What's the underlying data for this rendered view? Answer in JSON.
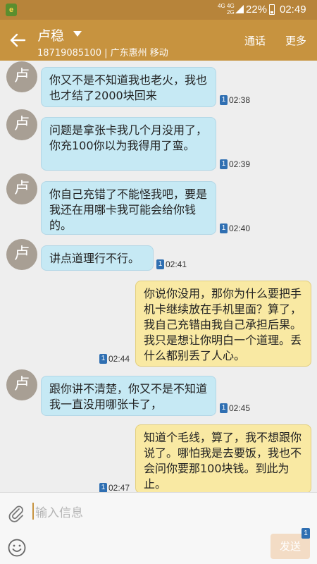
{
  "status_bar": {
    "app_icon_label": "e",
    "network_1": "4G",
    "network_2": "4G",
    "network_3": "2G",
    "battery": "22%",
    "time": "02:49"
  },
  "header": {
    "contact_name": "卢稳",
    "contact_sub": "18719085100 | 广东惠州 移动",
    "call_label": "通话",
    "more_label": "更多"
  },
  "avatar_label": "卢",
  "sim_label": "1",
  "messages": [
    {
      "direction": "in",
      "text": "你又不是不知道我也老火，我也也才结了2000块回来",
      "time": "02:38"
    },
    {
      "direction": "in",
      "text": "问题是拿张卡我几个月没用了，你充100你以为我得用了蛮。",
      "time": "02:39"
    },
    {
      "direction": "in",
      "text": "你自己充错了不能怪我吧，要是我还在用哪卡我可能会给你钱的。",
      "time": "02:40"
    },
    {
      "direction": "in",
      "text": "讲点道理行不行。",
      "time": "02:41"
    },
    {
      "direction": "out",
      "text": "你说你没用，那你为什么要把手机卡继续放在手机里面？算了，我自己充错由我自己承担后果。我只是想让你明白一个道理。丢什么都别丢了人心。",
      "time": "02:44"
    },
    {
      "direction": "in",
      "text": "跟你讲不清楚，你又不是不知道我一直没用哪张卡了，",
      "time": "02:45"
    },
    {
      "direction": "out",
      "text": "知道个毛线，算了，我不想跟你说了。哪怕我是去要饭，我也不会问你要那100块钱。到此为止。",
      "time": "02:47"
    }
  ],
  "input": {
    "placeholder": "输入信息",
    "send_label": "发送"
  },
  "colors": {
    "header": "#c7933f",
    "status_bar": "#b7843a",
    "incoming_bubble": "#c6e9f4",
    "outgoing_bubble": "#f9e9a3",
    "avatar": "#a89f94",
    "sim_badge": "#2f6fb2"
  },
  "icons": [
    "back-arrow-icon",
    "dropdown-caret-icon",
    "attachment-icon",
    "emoji-icon",
    "sim-1-icon",
    "signal-icon",
    "battery-icon"
  ]
}
